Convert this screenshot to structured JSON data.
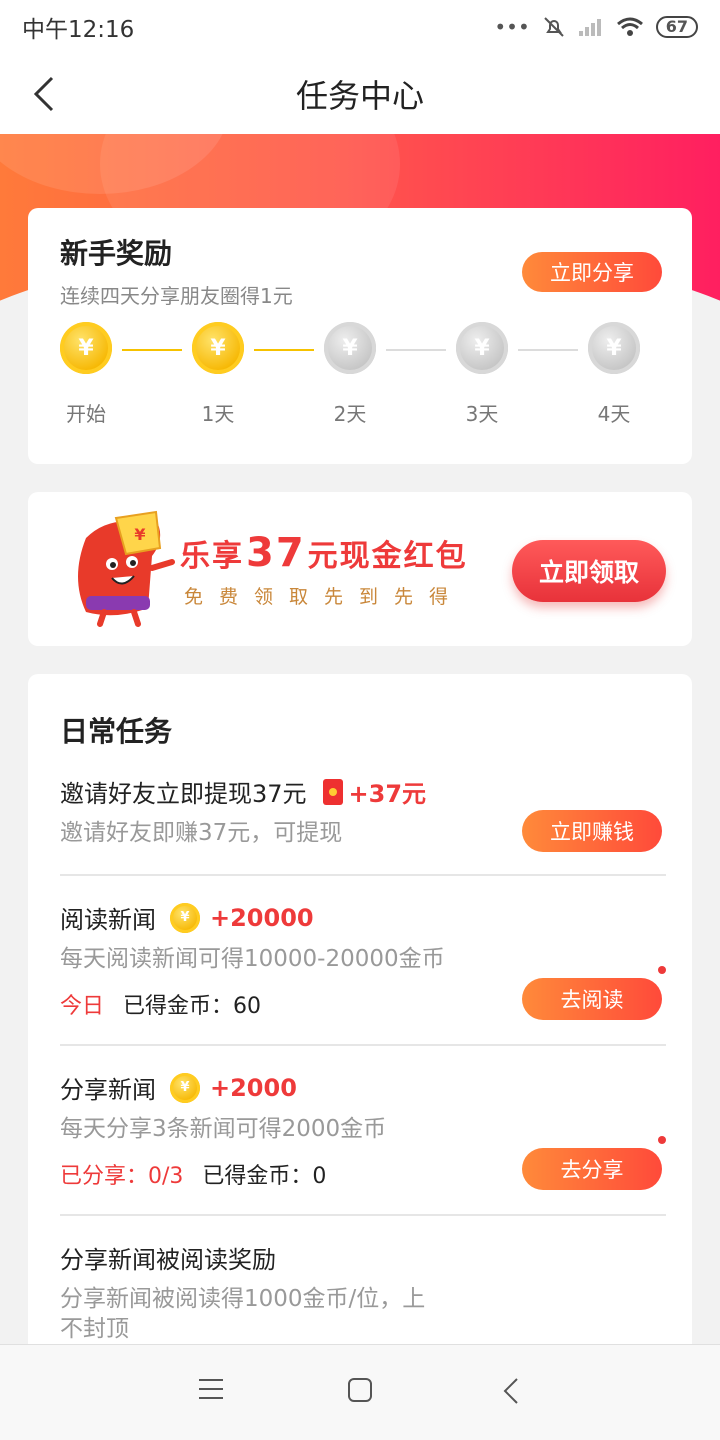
{
  "status": {
    "time": "中午12:16",
    "battery": "67"
  },
  "nav": {
    "title": "任务中心"
  },
  "newbie": {
    "title": "新手奖励",
    "subtitle": "连续四天分享朋友圈得1元",
    "button": "立即分享",
    "coin_symbol": "¥",
    "steps": [
      {
        "label": "开始",
        "done": true
      },
      {
        "label": "1天",
        "done": true
      },
      {
        "label": "2天",
        "done": false
      },
      {
        "label": "3天",
        "done": false
      },
      {
        "label": "4天",
        "done": false
      }
    ]
  },
  "promo": {
    "title_prefix": "乐享",
    "amount": "37",
    "title_suffix": "元现金红包",
    "subtitle": "免费领取先到先得",
    "button": "立即领取",
    "mascot_sign": "¥"
  },
  "daily": {
    "title": "日常任务",
    "tasks": [
      {
        "title": "邀请好友立即提现37元",
        "reward": "+37元",
        "desc": "邀请好友即赚37元，可提现",
        "button": "立即赚钱"
      },
      {
        "title": "阅读新闻",
        "reward": "+20000",
        "desc": "每天阅读新闻可得10000-20000金币",
        "stat_red": "今日",
        "stat": "已得金币：60",
        "button": "去阅读"
      },
      {
        "title": "分享新闻",
        "reward": "+2000",
        "desc": "每天分享3条新闻可得2000金币",
        "stat_red": "已分享：0/3",
        "stat": "已得金币：0",
        "button": "去分享"
      },
      {
        "title": "分享新闻被阅读奖励",
        "desc_line1": "分享新闻被阅读得1000金币/位，上",
        "desc_line2": "不封顶"
      }
    ]
  },
  "colors": {
    "accent": "#ee3a3a",
    "gold": "#f6b600",
    "button_gradient_start": "#ff8a3a",
    "button_gradient_end": "#ff4a3a"
  }
}
